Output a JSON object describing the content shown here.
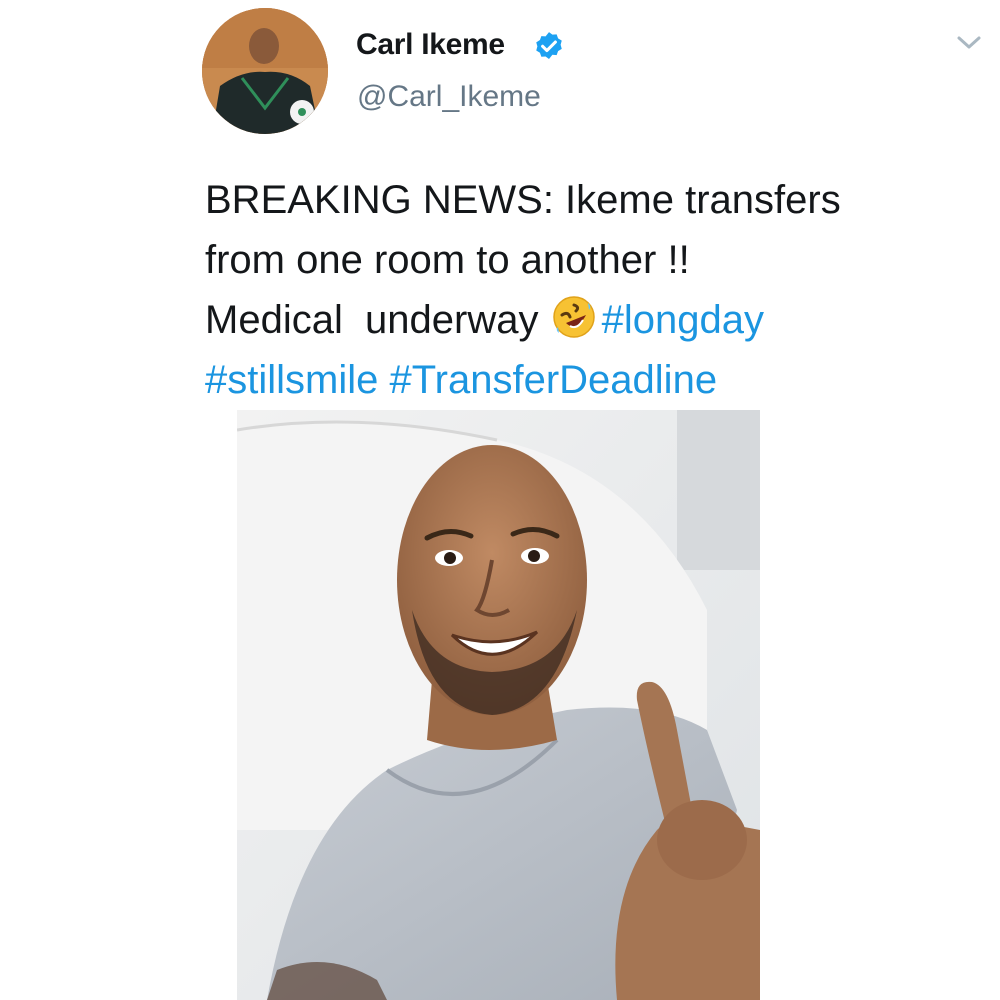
{
  "tweet": {
    "author": {
      "display_name": "Carl Ikeme",
      "handle": "@Carl_Ikeme",
      "verified": true,
      "avatar_icon": "profile-photo"
    },
    "text": {
      "line1": "BREAKING NEWS: Ikeme transfers",
      "line2": "from one room to another !!",
      "line3_text": "Medical  underway ",
      "emoji": "rolling-on-the-floor-laughing-emoji",
      "hashtags": [
        "#longday",
        "#stillsmile",
        "#TransferDeadline"
      ]
    },
    "media": {
      "type": "photo"
    },
    "menu_icon": "chevron-down-icon"
  },
  "colors": {
    "text": "#14171a",
    "handle": "#657786",
    "hashtag": "#1b95e0",
    "verified": "#1da1f2"
  }
}
